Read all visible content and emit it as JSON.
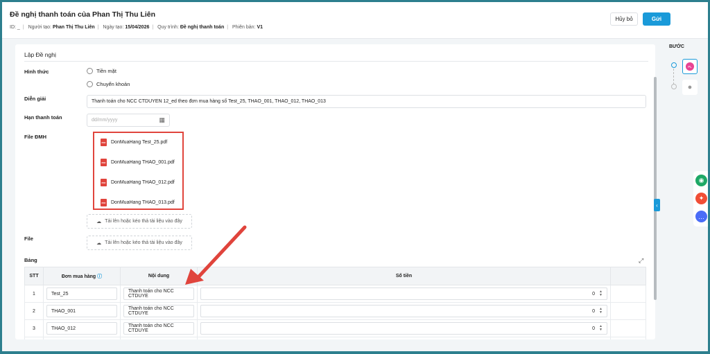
{
  "header": {
    "title": "Đề nghị thanh toán của Phan Thị Thu Liên",
    "meta": {
      "id_label": "ID:",
      "id_value": "_",
      "creator_label": "Người tạo:",
      "creator": "Phan Thị Thu Liên",
      "date_label": "Ngày tạo:",
      "date": "15/04/2026",
      "process_label": "Quy trình:",
      "process": "Đề nghị thanh toán",
      "version_label": "Phiên bản:",
      "version": "V1"
    },
    "cancel_label": "Hủy bỏ",
    "send_label": "Gửi"
  },
  "form": {
    "title": "Lập Đề nghị",
    "method_label": "Hình thức",
    "method_options": [
      "Tiền mặt",
      "Chuyển khoản"
    ],
    "description_label": "Diễn giải",
    "description_value": "Thanh toán cho NCC CTDUYEN 12_ed theo đơn mua hàng số Test_25, THAO_001, THAO_012, THAO_013",
    "due_label": "Hạn thanh toán",
    "due_placeholder": "dd/mm/yyyy",
    "file_dmh_label": "File ĐMH",
    "files": [
      "DonMuaHang Test_25.pdf",
      "DonMuaHang THAO_001.pdf",
      "DonMuaHang THAO_012.pdf",
      "DonMuaHang THAO_013.pdf"
    ],
    "upload_label": "Tải lên hoặc kéo thả tài liệu vào đây",
    "file_label": "File",
    "table_label": "Bảng"
  },
  "table": {
    "headers": [
      "STT",
      "Đơn mua hàng",
      "Nội dung",
      "Số tiền"
    ],
    "rows": [
      {
        "stt": "1",
        "order": "Test_25",
        "content": "Thanh toán cho NCC CTDUYE",
        "amount": "0"
      },
      {
        "stt": "2",
        "order": "THAO_001",
        "content": "Thanh toán cho NCC CTDUYE",
        "amount": "0"
      },
      {
        "stt": "3",
        "order": "THAO_012",
        "content": "Thanh toán cho NCC CTDUYE",
        "amount": "0"
      }
    ]
  },
  "steps": {
    "title": "BƯỚC",
    "avatar_initials": "PL"
  },
  "colors": {
    "accent": "#1a9ad9",
    "highlight": "#e0443c",
    "border": "#2d7f8e"
  }
}
